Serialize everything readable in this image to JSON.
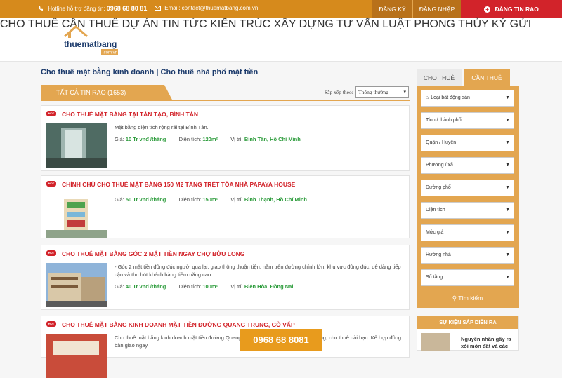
{
  "topbar": {
    "hotline_label": "Hotline hỗ trợ đăng tin:",
    "hotline_number": "0968 68 80 81",
    "email_label": "Email: contact@thuematbang.com.vn",
    "register": "ĐĂNG KÝ",
    "login": "ĐĂNG NHẬP",
    "post": "ĐĂNG TIN RAO"
  },
  "logo": {
    "main": "thuematbang",
    "sub": ".com.vn"
  },
  "nav": [
    "CHO THUÊ",
    "CẦN THUÊ",
    "DỰ ÁN",
    "TIN TỨC",
    "KIẾN TRÚC XÂY DỰNG",
    "TƯ VẤN LUẬT",
    "PHONG THỦY",
    "KÝ GỬI"
  ],
  "page_title": "Cho thuê mặt bằng kinh doanh | Cho thuê nhà phố mặt tiền",
  "listing_tab": "TẤT CẢ TIN RAO (1653)",
  "sort": {
    "label": "Sắp xếp theo:",
    "value": "Thông thường"
  },
  "listings": [
    {
      "title": "CHO THUÊ MẶT BẰNG TẠI TÂN TẠO, BÌNH TÂN",
      "desc": "Mặt bằng diện tích rộng rãi tại Bình Tân.",
      "price_label": "Giá:",
      "price": "10 Tr vnđ /tháng",
      "area_label": "Diện tích:",
      "area": "120m²",
      "loc_label": "Vị trí:",
      "loc": "Bình Tân, Hồ Chí Minh"
    },
    {
      "title": "CHÍNH CHỦ CHO THUÊ MẶT BẰNG 150 M2 TẦNG TRỆT TÒA NHÀ PAPAYA HOUSE",
      "desc": "",
      "price_label": "Giá:",
      "price": "50 Tr vnđ /tháng",
      "area_label": "Diện tích:",
      "area": "150m²",
      "loc_label": "Vị trí:",
      "loc": "Bình Thạnh, Hồ Chí Minh"
    },
    {
      "title": "CHO THUÊ MẶT BẰNG GÓC 2 MẶT TIỀN NGAY CHỢ BỬU LONG",
      "desc": "- Góc 2 mặt tiền đông đúc người qua lại, giao thông thuận tiện, nằm trên đường chính lớn, khu vực đông đúc, dễ dàng tiếp cận và thu hút khách hàng tiềm năng cao.",
      "price_label": "Giá:",
      "price": "40 Tr vnđ /tháng",
      "area_label": "Diện tích:",
      "area": "100m²",
      "loc_label": "Vị trí:",
      "loc": "Biên Hòa, Đồng Nai"
    },
    {
      "title": "CHO THUÊ MẶT BẰNG KINH DOANH MẶT TIỀN ĐƯỜNG QUANG TRUNG, GÒ VẤP",
      "desc": "Cho thuê mặt bằng kinh doanh mặt tiền đường Quang Trung, Gò Vấp. Diện tích 55tr/tháng, cho thuê dài hạn. Kế hợp đồng bàn giao ngay."
    }
  ],
  "sidebar": {
    "tab_rent": "CHO THUÊ",
    "tab_need": "CẦN THUÊ",
    "filters": [
      "Loại bất động sản",
      "Tỉnh / thành phố",
      "Quận / Huyện",
      "Phường / xã",
      "Đường phố",
      "Diện tích",
      "Mức giá",
      "Hướng nhà",
      "Số tầng"
    ],
    "search_button": "Tìm kiếm",
    "events_title": "SỰ KIỆN SẮP DIỄN RA",
    "event_text": "Nguyên nhân gây ra xói mòn đất và các"
  },
  "floating_phone": "0968 68 8081",
  "colors": {
    "brand_orange": "#e3a650",
    "dark_orange": "#d68a1c",
    "red": "#d2232a",
    "navy": "#1b3a6b",
    "green": "#2d9c3c"
  }
}
